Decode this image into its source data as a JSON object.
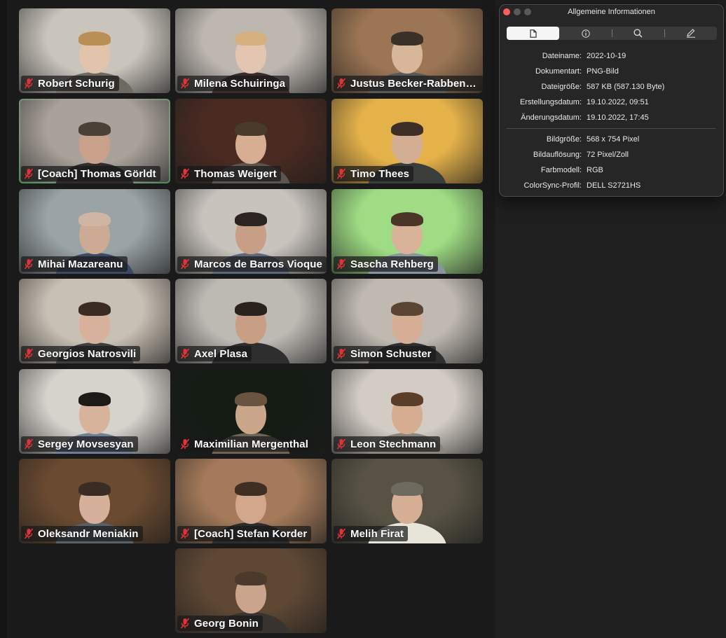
{
  "participants": [
    {
      "name": "Robert Schurig",
      "mic": "mic-muted-icon",
      "bg": "#c9c4bc",
      "skin": "#e2c3ab",
      "shirt": "#6d6a62",
      "hair": "#b98f55"
    },
    {
      "name": "Milena Schuiringa",
      "mic": "mic-muted-icon",
      "bg": "#bdb7b0",
      "skin": "#e4c5b1",
      "shirt": "#3b2b2b",
      "hair": "#d3b07e"
    },
    {
      "name": "Justus Becker-Rabbenstein",
      "mic": "mic-muted-icon",
      "bg": "#9b7554",
      "skin": "#d8b69a",
      "shirt": "#595959",
      "hair": "#3a3028"
    },
    {
      "name": "[Coach] Thomas Görldt",
      "mic": "mic-muted-icon",
      "bg": "#a9a29a",
      "skin": "#c9a089",
      "shirt": "#2d2d2d",
      "hair": "#4a4038",
      "active": true
    },
    {
      "name": "Thomas Weigert",
      "mic": "mic-muted-icon",
      "bg": "#4a2b22",
      "skin": "#d7ae92",
      "shirt": "#5a554f",
      "hair": "#4a3a2c"
    },
    {
      "name": "Timo Thees",
      "mic": "mic-muted-icon",
      "bg": "#e5b24a",
      "skin": "#d4ae93",
      "shirt": "#3a3e3a",
      "hair": "#3d2f25"
    },
    {
      "name": "Mihai Mazareanu",
      "mic": "mic-muted-icon",
      "bg": "#9aa3a6",
      "skin": "#ccaa94",
      "shirt": "#3a4a64",
      "hair": "#cfb5a3"
    },
    {
      "name": "Marcos de Barros Vioque",
      "mic": "mic-muted-icon",
      "bg": "#c8c3bd",
      "skin": "#c79f86",
      "shirt": "#5a6a7c",
      "hair": "#2b2420"
    },
    {
      "name": "Sascha Rehberg",
      "mic": "mic-muted-icon",
      "bg": "#9fdc84",
      "skin": "#d9b29a",
      "shirt": "#8896a0",
      "hair": "#4a3526"
    },
    {
      "name": "Georgios Natrosvili",
      "mic": "mic-muted-icon",
      "bg": "#c9c0b4",
      "skin": "#d7b19b",
      "shirt": "#3e3f3f",
      "hair": "#3a2c22"
    },
    {
      "name": "Axel Plasa",
      "mic": "mic-muted-icon",
      "bg": "#bcbab3",
      "skin": "#c89e85",
      "shirt": "#2e2e2e",
      "hair": "#2a221d"
    },
    {
      "name": "Simon Schuster",
      "mic": "mic-muted-icon",
      "bg": "#bfb9b1",
      "skin": "#d6ae96",
      "shirt": "#2f2f2f",
      "hair": "#5a4434"
    },
    {
      "name": "Sergey Movsesyan",
      "mic": "mic-muted-icon",
      "bg": "#d6d2cc",
      "skin": "#d7b39b",
      "shirt": "#6e7e94",
      "hair": "#1e1a17"
    },
    {
      "name": "Maximilian Mergenthal",
      "mic": "mic-muted-icon",
      "bg": "#141c14",
      "skin": "#caa68b",
      "shirt": "#6d6457",
      "hair": "#6a5440"
    },
    {
      "name": "Leon Stechmann",
      "mic": "mic-muted-icon",
      "bg": "#d2ccc4",
      "skin": "#d6ad91",
      "shirt": "#8a8479",
      "hair": "#5a3e2a"
    },
    {
      "name": "Oleksandr Meniakin",
      "mic": "mic-muted-icon",
      "bg": "#6a4a30",
      "skin": "#d5b09a",
      "shirt": "#58606a",
      "hair": "#3b2c23"
    },
    {
      "name": "[Coach] Stefan Korder",
      "mic": "mic-muted-icon",
      "bg": "#a47a5a",
      "skin": "#d2a78b",
      "shirt": "#2c2c2c",
      "hair": "#3f2e22"
    },
    {
      "name": "Melih Firat",
      "mic": "mic-muted-icon",
      "bg": "#575244",
      "skin": "#d6ae93",
      "shirt": "#e7e4d9",
      "hair": "#6f6a60"
    },
    {
      "name": "Georg Bonin",
      "mic": "mic-muted-icon",
      "bg": "#5e4834",
      "skin": "#caa48c",
      "shirt": "#3a3430",
      "hair": "#4b3a2c"
    }
  ],
  "info_window": {
    "title": "Allgemeine Informationen",
    "tabs": [
      "document-icon",
      "info-icon",
      "search-icon",
      "pencil-icon"
    ],
    "general": [
      {
        "key": "Dateiname:",
        "value": "2022-10-19"
      },
      {
        "key": "Dokumentart:",
        "value": "PNG-Bild"
      },
      {
        "key": "Dateigröße:",
        "value": "587 KB (587.130 Byte)"
      },
      {
        "key": "Erstellungsdatum:",
        "value": "19.10.2022, 09:51"
      },
      {
        "key": "Änderungsdatum:",
        "value": "19.10.2022, 17:45"
      }
    ],
    "image": [
      {
        "key": "Bildgröße:",
        "value": "568 x 754 Pixel"
      },
      {
        "key": "Bildauflösung:",
        "value": "72 Pixel/Zoll"
      },
      {
        "key": "Farbmodell:",
        "value": "RGB"
      },
      {
        "key": "ColorSync-Profil:",
        "value": "DELL S2721HS"
      }
    ]
  },
  "colors": {
    "active_speaker_border": "#39c65a",
    "muted_mic": "#e0323a",
    "close_button": "#ff5f57"
  }
}
